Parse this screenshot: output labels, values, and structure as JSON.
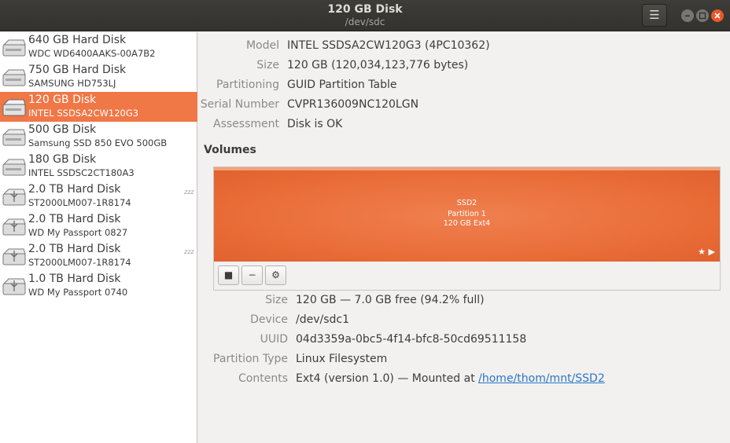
{
  "window": {
    "title": "120 GB Disk",
    "subtitle": "/dev/sdc",
    "menu_icon": "hamburger-icon",
    "buttons": [
      "minimize",
      "maximize",
      "close"
    ]
  },
  "sidebar": {
    "items": [
      {
        "name": "640 GB Hard Disk",
        "model": "WDC WD6400AAKS-00A7B2",
        "icon": "hard-disk-icon",
        "selected": false,
        "sleeping": false
      },
      {
        "name": "750 GB Hard Disk",
        "model": "SAMSUNG HD753LJ",
        "icon": "hard-disk-icon",
        "selected": false,
        "sleeping": false
      },
      {
        "name": "120 GB Disk",
        "model": "INTEL SSDSA2CW120G3",
        "icon": "hard-disk-icon",
        "selected": true,
        "sleeping": false
      },
      {
        "name": "500 GB Disk",
        "model": "Samsung SSD 850 EVO 500GB",
        "icon": "hard-disk-icon",
        "selected": false,
        "sleeping": false
      },
      {
        "name": "180 GB Disk",
        "model": "INTEL SSDSC2CT180A3",
        "icon": "hard-disk-icon",
        "selected": false,
        "sleeping": false
      },
      {
        "name": "2.0 TB Hard Disk",
        "model": "ST2000LM007-1R8174",
        "icon": "usb-disk-icon",
        "selected": false,
        "sleeping": true,
        "sleep_text": "zzz"
      },
      {
        "name": "2.0 TB Hard Disk",
        "model": "WD My Passport 0827",
        "icon": "usb-disk-icon",
        "selected": false,
        "sleeping": false
      },
      {
        "name": "2.0 TB Hard Disk",
        "model": "ST2000LM007-1R8174",
        "icon": "usb-disk-icon",
        "selected": false,
        "sleeping": true,
        "sleep_text": "zzz"
      },
      {
        "name": "1.0 TB Hard Disk",
        "model": "WD My Passport 0740",
        "icon": "usb-disk-icon",
        "selected": false,
        "sleeping": false
      }
    ]
  },
  "disk_info": {
    "model_label": "Model",
    "model": "INTEL SSDSA2CW120G3 (4PC10362)",
    "size_label": "Size",
    "size": "120 GB (120,034,123,776 bytes)",
    "partitioning_label": "Partitioning",
    "partitioning": "GUID Partition Table",
    "serial_label": "Serial Number",
    "serial": "CVPR136009NC120LGN",
    "assessment_label": "Assessment",
    "assessment": "Disk is OK"
  },
  "volumes": {
    "title": "Volumes",
    "partition": {
      "name": "SSD2",
      "number": "Partition 1",
      "desc": "120 GB Ext4",
      "color": "#e86b35"
    },
    "toolbar": {
      "stop_icon": "stop-icon",
      "remove_icon": "minus-icon",
      "settings_icon": "gears-icon"
    }
  },
  "volume_info": {
    "size_label": "Size",
    "size": "120 GB — 7.0 GB free (94.2% full)",
    "device_label": "Device",
    "device": "/dev/sdc1",
    "uuid_label": "UUID",
    "uuid": "04d3359a-0bc5-4f14-bfc8-50cd69511158",
    "ptype_label": "Partition Type",
    "ptype": "Linux Filesystem",
    "contents_label": "Contents",
    "contents_prefix": "Ext4 (version 1.0) — Mounted at ",
    "mount_link": "/home/thom/mnt/SSD2"
  },
  "colors": {
    "accent": "#f07746",
    "titlebar": "#3a3935",
    "close": "#e8592a",
    "link": "#2a76c6"
  }
}
